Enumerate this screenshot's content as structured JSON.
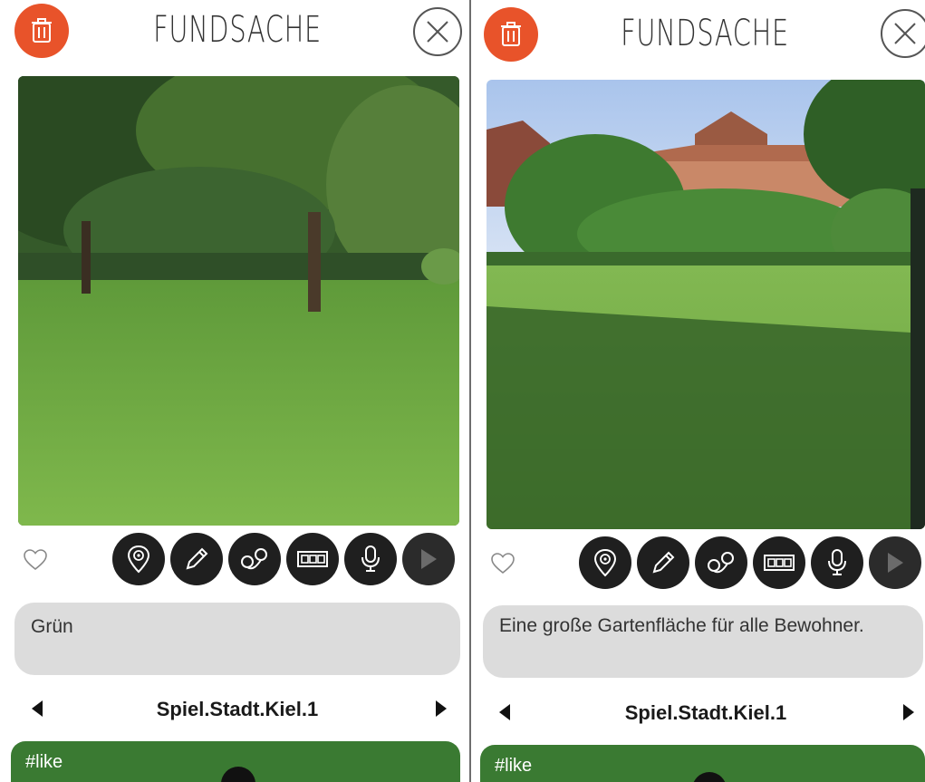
{
  "screens": [
    {
      "title": "FUNDSACHE",
      "description": "Grün",
      "nav_label": "Spiel.Stadt.Kiel.1",
      "like_label": "#like"
    },
    {
      "title": "FUNDSACHE",
      "description": "Eine große Gartenfläche für alle Bewohner.",
      "nav_label": "Spiel.Stadt.Kiel.1",
      "like_label": "#like"
    }
  ],
  "icons": {
    "delete": "trash-icon",
    "close": "close-icon",
    "favorite": "heart-icon",
    "tools": [
      "location-pin-icon",
      "pencil-icon",
      "route-icon",
      "film-strip-icon",
      "microphone-icon",
      "play-icon"
    ],
    "prev": "arrow-left-icon",
    "next": "arrow-right-icon"
  },
  "colors": {
    "accent": "#e8532a",
    "like_bar": "#3a7a32",
    "description_bg": "#dcdcdc",
    "tool_bg": "#1f1f1f"
  }
}
